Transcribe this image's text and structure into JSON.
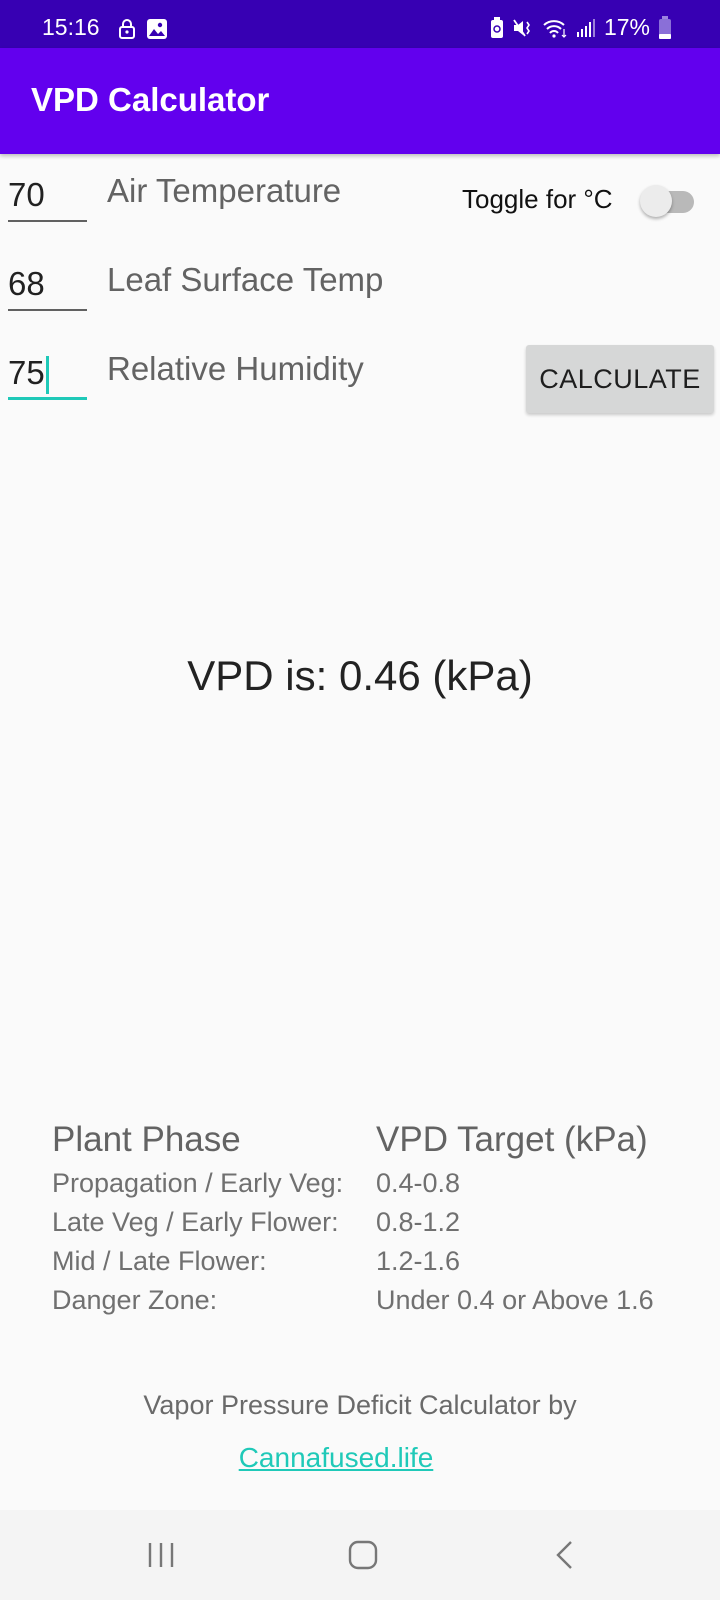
{
  "status_bar": {
    "time": "15:16",
    "left_icons": [
      "lock-icon",
      "image-icon"
    ],
    "right_icons": [
      "battery-saver-icon",
      "mute-vibrate-icon",
      "wifi-icon",
      "signal-icon"
    ],
    "battery": "17%"
  },
  "app_bar": {
    "title": "VPD Calculator"
  },
  "inputs": [
    {
      "value": "70",
      "label": "Air Temperature"
    },
    {
      "value": "68",
      "label": "Leaf Surface Temp"
    },
    {
      "value": "75",
      "label": "Relative Humidity"
    }
  ],
  "toggle": {
    "label": "Toggle for °C",
    "on": false
  },
  "calculate_button": {
    "label": "CALCULATE"
  },
  "result": {
    "text": "VPD is: 0.46 (kPa)"
  },
  "targets_table": {
    "headers": [
      "Plant Phase",
      "VPD Target (kPa)"
    ],
    "rows": [
      {
        "phase": "Propagation / Early Veg:",
        "target": "0.4-0.8"
      },
      {
        "phase": "Late Veg / Early Flower:",
        "target": "0.8-1.2"
      },
      {
        "phase": "Mid / Late Flower:",
        "target": "1.2-1.6"
      },
      {
        "phase": "Danger Zone:",
        "target": "Under 0.4 or Above 1.6"
      }
    ]
  },
  "footer": {
    "credit": "Vapor Pressure Deficit Calculator by",
    "link": "Cannafused.life",
    "link_color": "#1fc9b8"
  },
  "nav_bar": {
    "buttons": [
      "recents",
      "home",
      "back"
    ]
  },
  "colors": {
    "primary": "#6200ee",
    "primary_dark": "#3700b3",
    "accent": "#1fc9b8"
  }
}
